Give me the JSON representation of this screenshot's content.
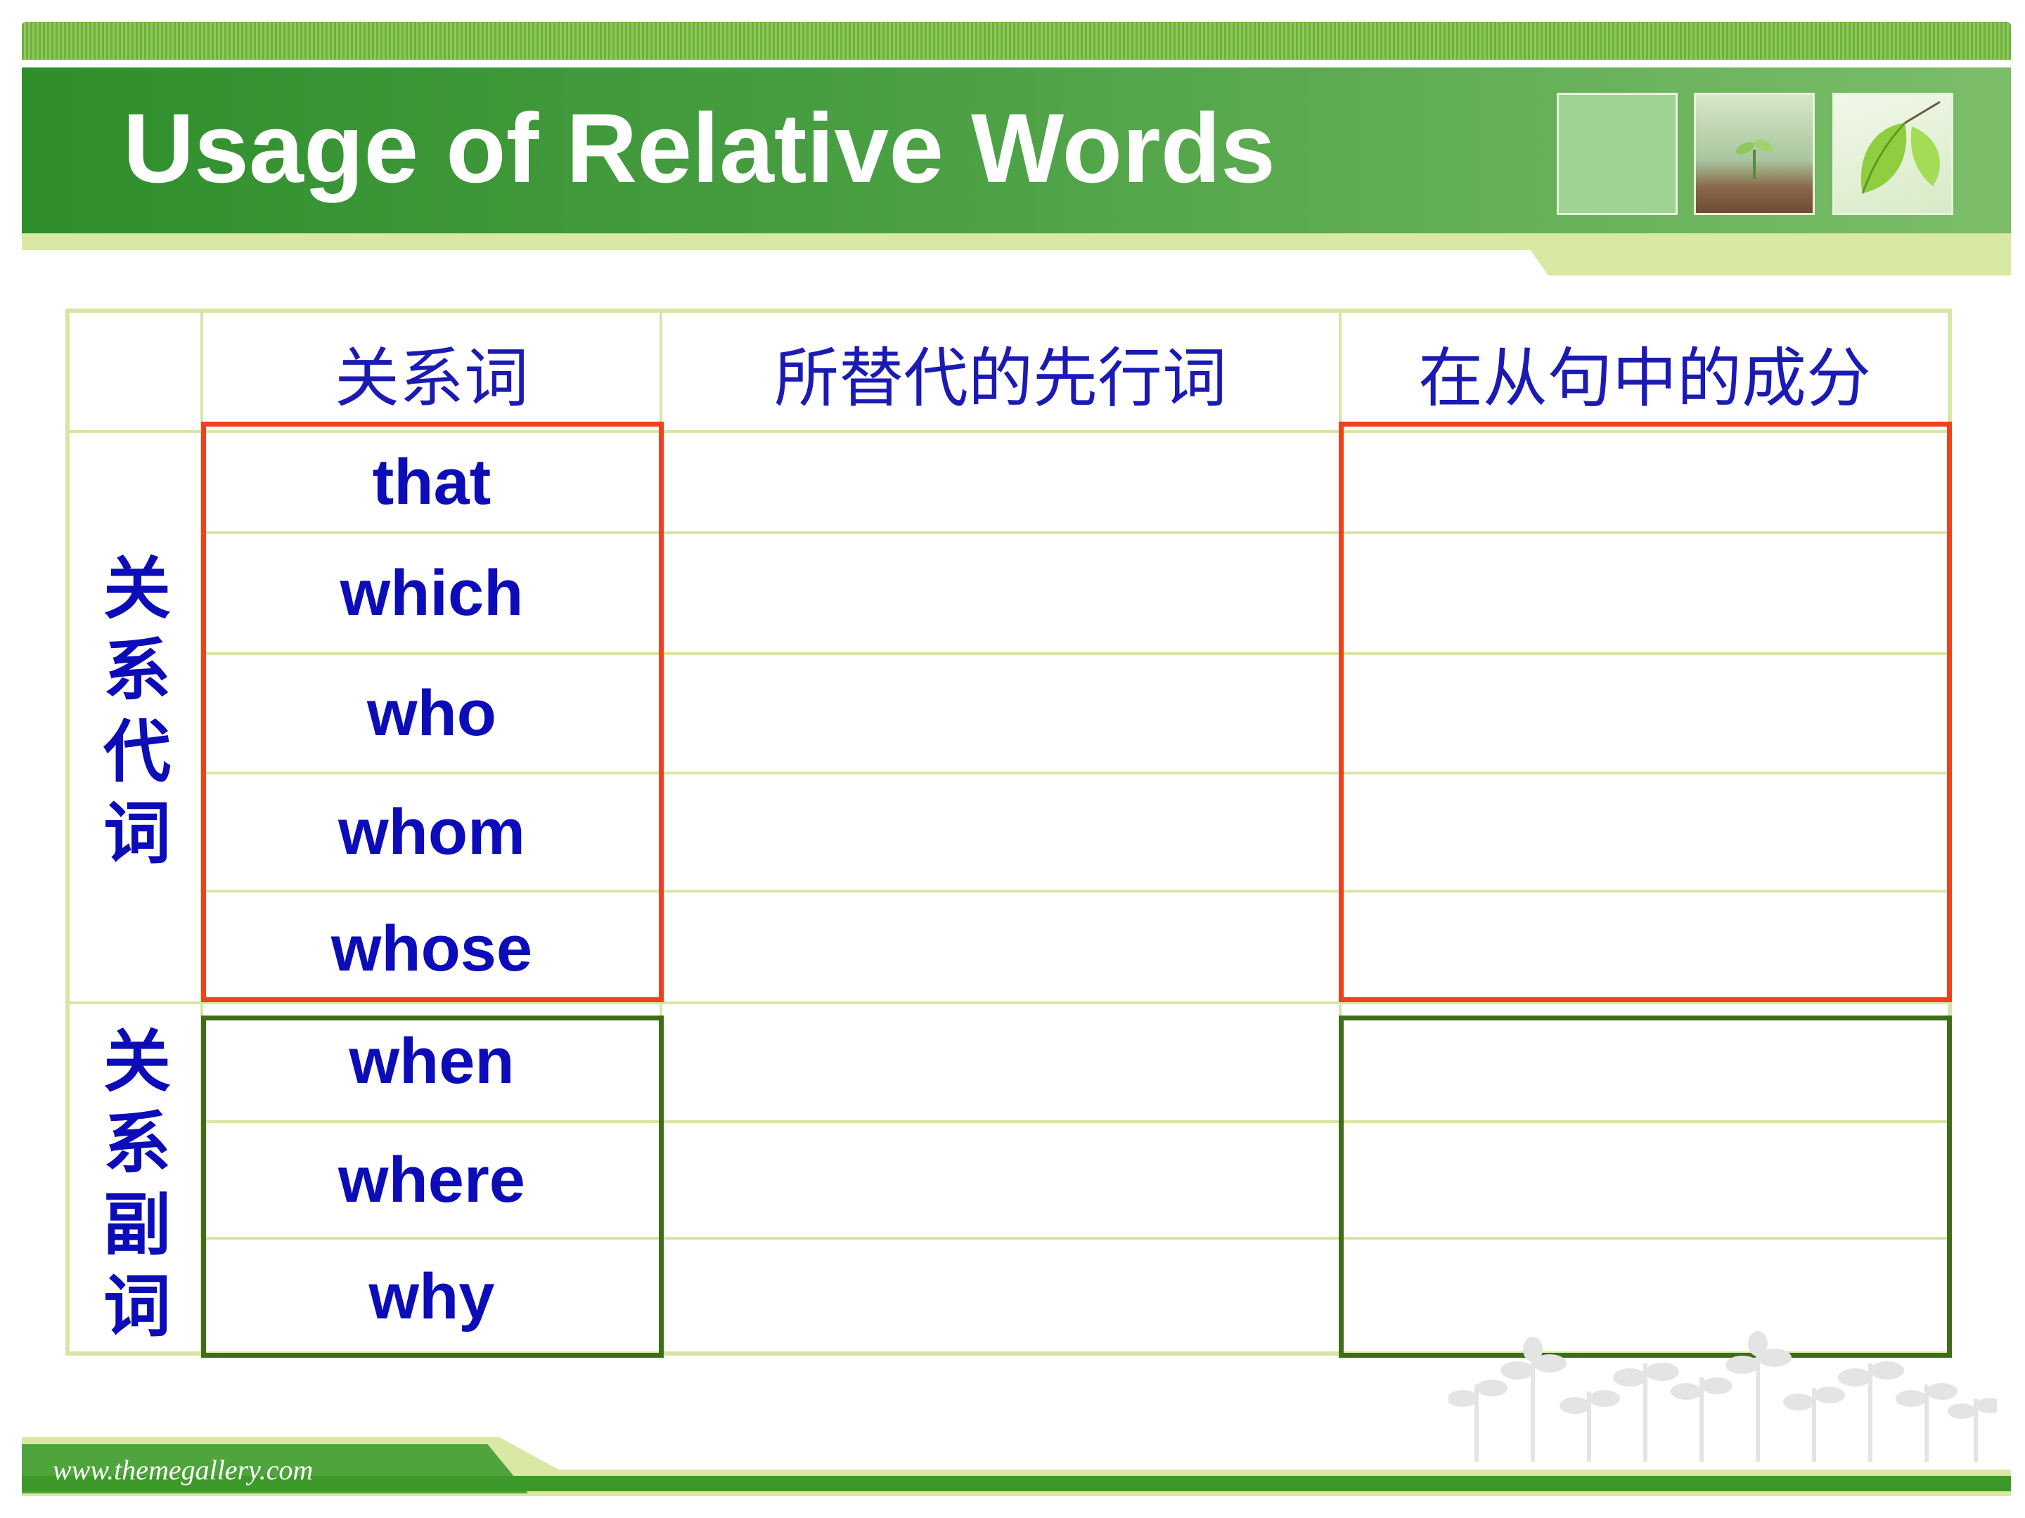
{
  "header": {
    "title": "Usage of Relative Words"
  },
  "table": {
    "columns": [
      "关系词",
      "所替代的先行词",
      "在从句中的成分"
    ],
    "groups": [
      {
        "label": "关系代词",
        "words": [
          "that",
          "which",
          "who",
          "whom",
          "whose"
        ]
      },
      {
        "label": "关系副词",
        "words": [
          "when",
          "where",
          "why"
        ]
      }
    ]
  },
  "footer": {
    "url": "www.themegallery.com"
  },
  "colors": {
    "accent_green": "#4aa043",
    "text_blue": "#0c0cb8",
    "pronoun_box": "#f0401d",
    "adverb_box": "#3f6e1b",
    "grid_line": "#d8e6a4"
  },
  "icons": [
    "seedling-photo",
    "leaf-photo",
    "plant-silhouettes-decoration"
  ]
}
